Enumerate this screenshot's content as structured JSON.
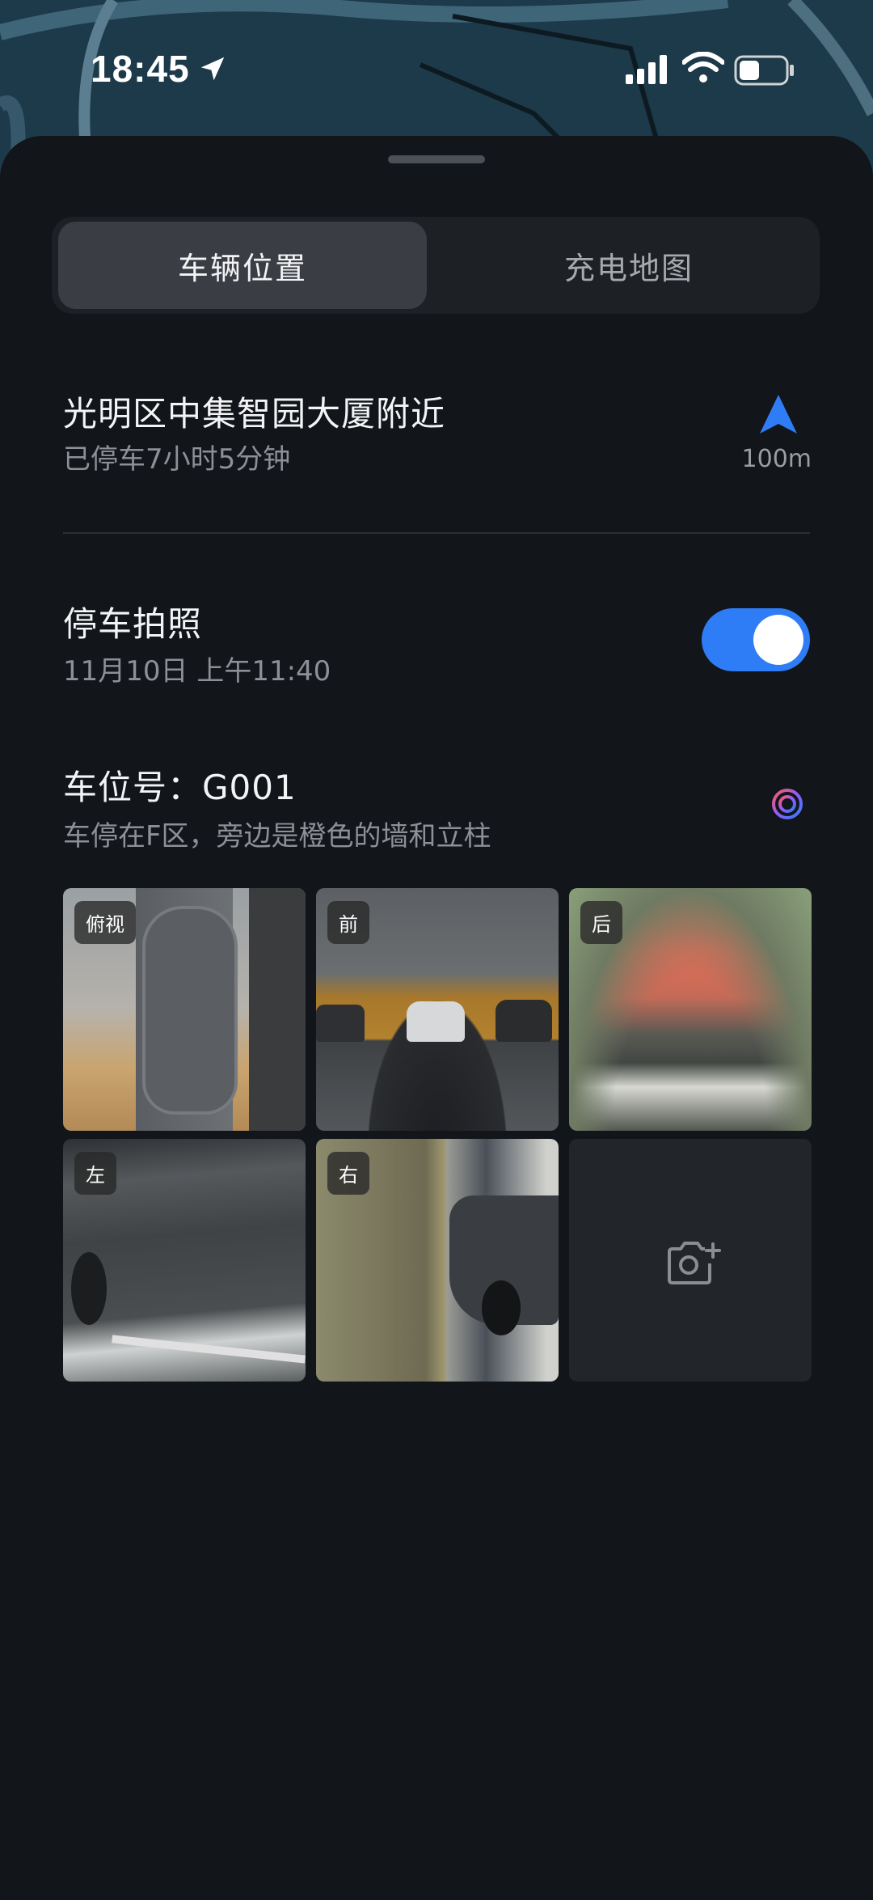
{
  "status_bar": {
    "time": "18:45"
  },
  "tabs": [
    {
      "label": "车辆位置",
      "active": true
    },
    {
      "label": "充电地图",
      "active": false
    }
  ],
  "location": {
    "title": "光明区中集智园大厦附近",
    "subtitle": "已停车7小时5分钟",
    "distance": "100m"
  },
  "parking_photo": {
    "title": "停车拍照",
    "timestamp": "11月10日 上午11:40",
    "toggle_on": true
  },
  "parking_spot": {
    "title": "车位号：G001",
    "description": "车停在F区，旁边是橙色的墙和立柱"
  },
  "photos": [
    {
      "label": "俯视"
    },
    {
      "label": "前"
    },
    {
      "label": "后"
    },
    {
      "label": "左"
    },
    {
      "label": "右"
    }
  ],
  "colors": {
    "accent": "#2f7df6",
    "background": "#121519"
  },
  "icons": {
    "navigate": "navigation-arrow-icon",
    "ai": "ai-swirl-icon",
    "add_photo": "camera-plus-icon"
  }
}
